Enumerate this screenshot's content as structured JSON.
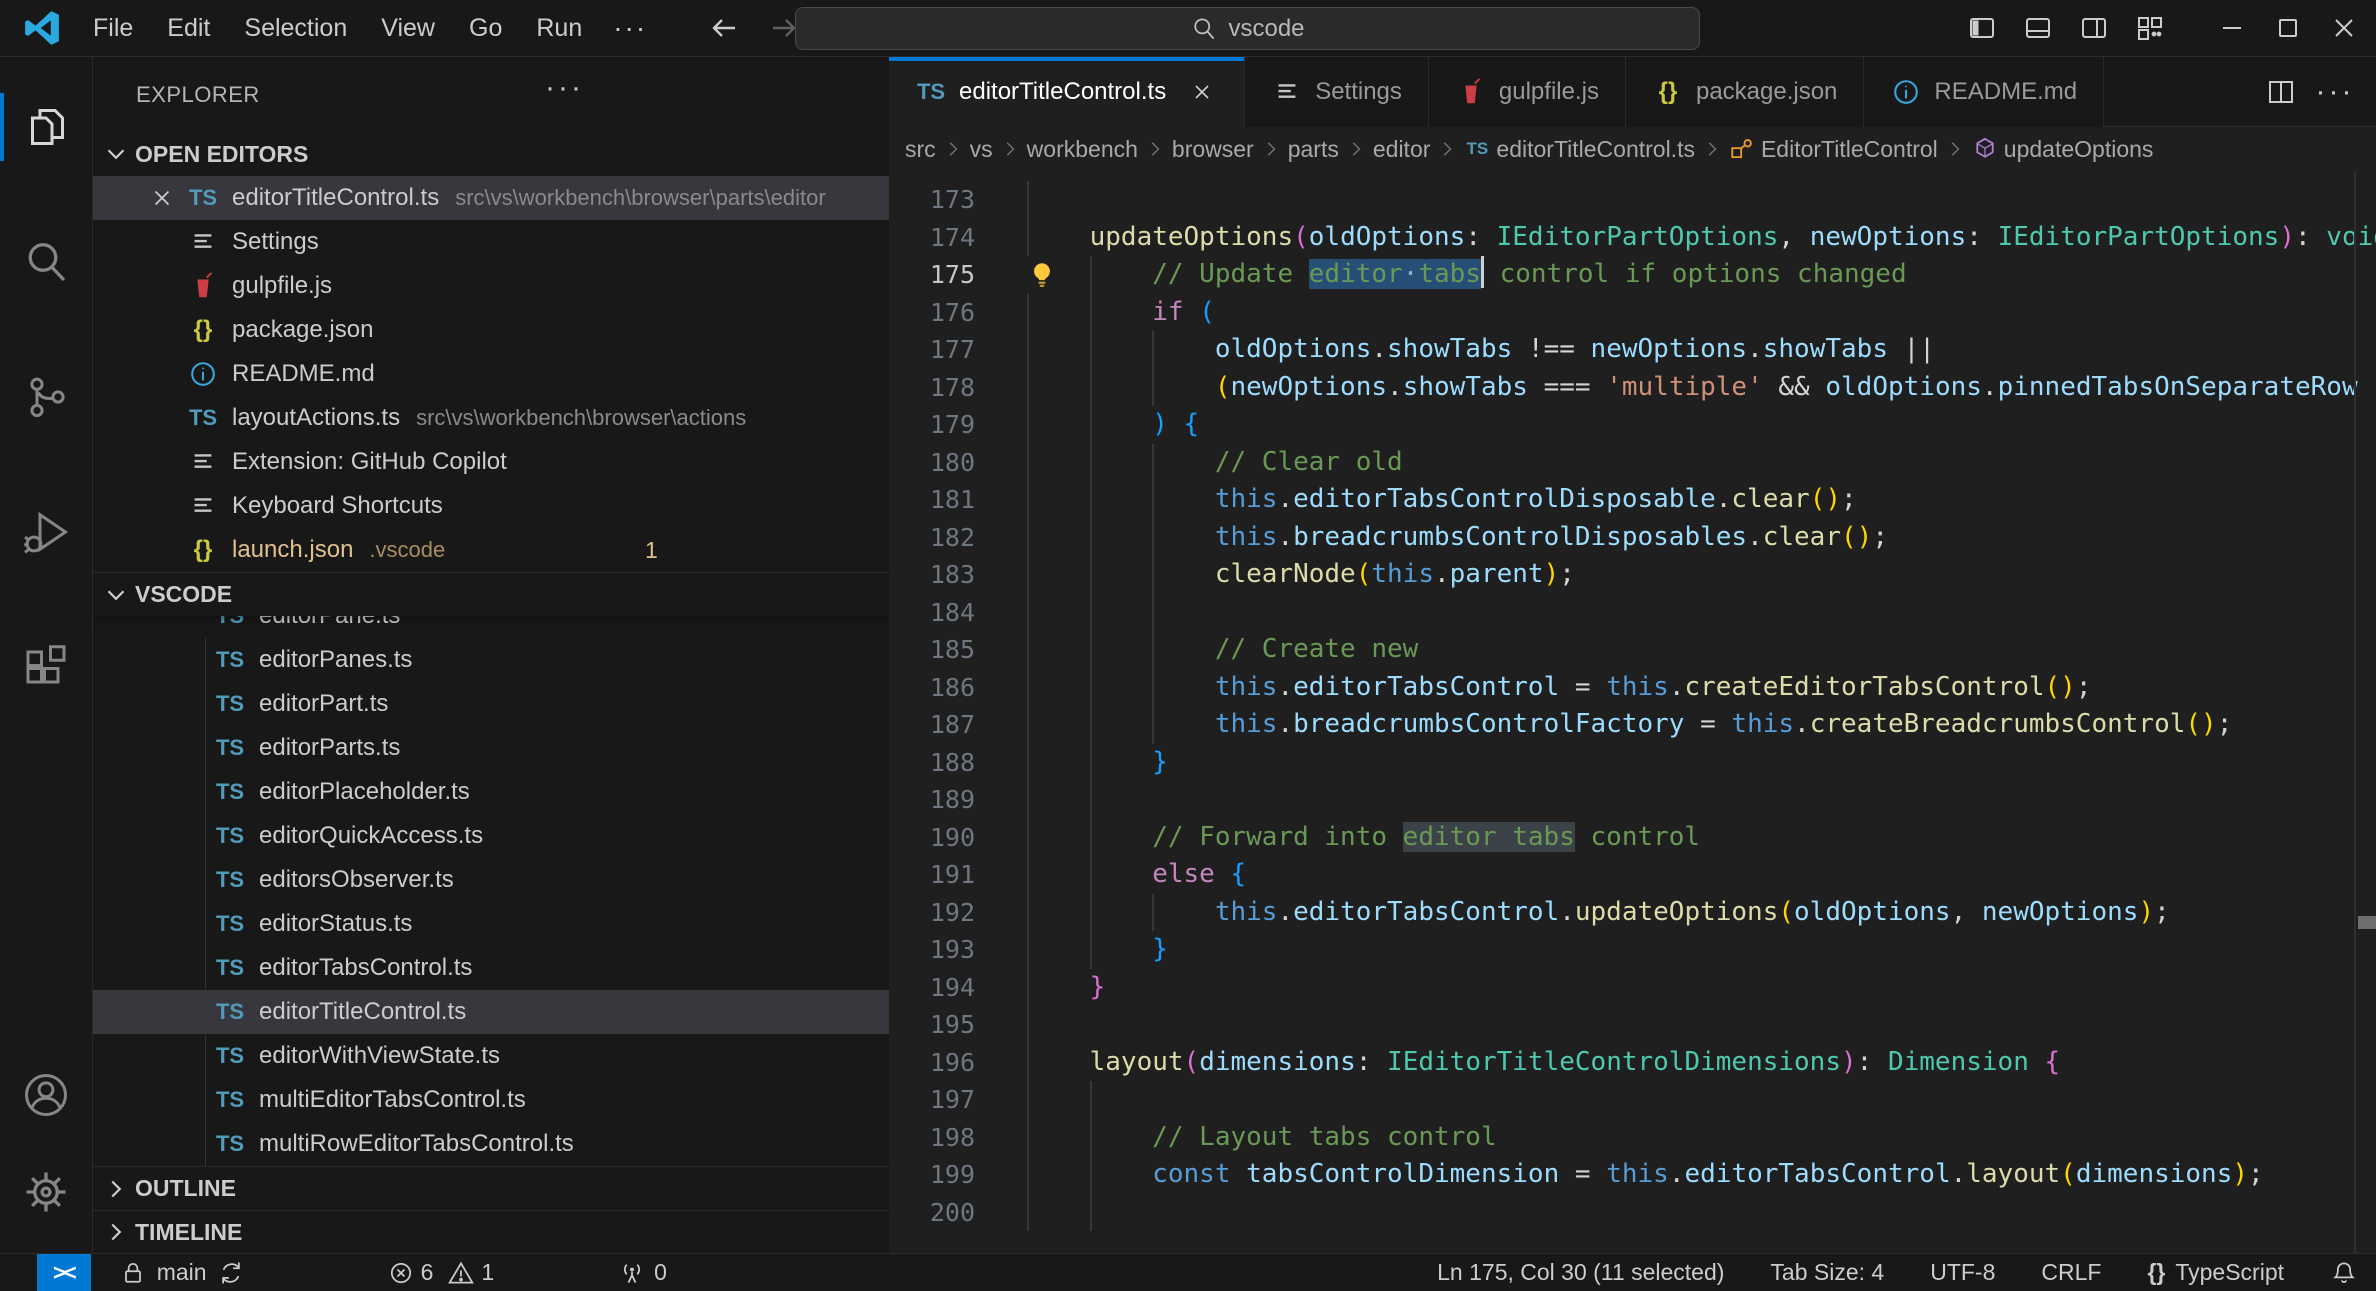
{
  "window": {
    "menus": [
      "File",
      "Edit",
      "Selection",
      "View",
      "Go",
      "Run"
    ],
    "more_label": "···",
    "search_value": "vscode"
  },
  "activity_bar": {
    "top": [
      {
        "icon": "files-icon",
        "active": true
      },
      {
        "icon": "search-icon"
      },
      {
        "icon": "source-control-icon"
      },
      {
        "icon": "run-debug-icon"
      },
      {
        "icon": "extensions-icon"
      }
    ],
    "bottom": [
      {
        "icon": "accounts-icon"
      },
      {
        "icon": "settings-gear-icon"
      }
    ]
  },
  "sidebar": {
    "title": "EXPLORER",
    "more_label": "···",
    "open_editors_label": "OPEN EDITORS",
    "open_editors": [
      {
        "icon": "ts",
        "name": "editorTitleControl.ts",
        "path": "src\\vs\\workbench\\browser\\parts\\editor",
        "selected": true,
        "close": true
      },
      {
        "icon": "settings",
        "name": "Settings"
      },
      {
        "icon": "gulp",
        "name": "gulpfile.js"
      },
      {
        "icon": "json",
        "name": "package.json"
      },
      {
        "icon": "info",
        "name": "README.md"
      },
      {
        "icon": "ts",
        "name": "layoutActions.ts",
        "path": "src\\vs\\workbench\\browser\\actions"
      },
      {
        "icon": "settings",
        "name": "Extension: GitHub Copilot"
      },
      {
        "icon": "settings",
        "name": "Keyboard Shortcuts"
      },
      {
        "icon": "json",
        "name": "launch.json",
        "path": ".vscode",
        "modified": true,
        "badge": "1"
      }
    ],
    "folder_label": "VSCODE",
    "tree_clipped_item": "editorPane.ts",
    "tree": [
      {
        "icon": "ts",
        "name": "editorPanes.ts"
      },
      {
        "icon": "ts",
        "name": "editorPart.ts"
      },
      {
        "icon": "ts",
        "name": "editorParts.ts"
      },
      {
        "icon": "ts",
        "name": "editorPlaceholder.ts"
      },
      {
        "icon": "ts",
        "name": "editorQuickAccess.ts"
      },
      {
        "icon": "ts",
        "name": "editorsObserver.ts"
      },
      {
        "icon": "ts",
        "name": "editorStatus.ts"
      },
      {
        "icon": "ts",
        "name": "editorTabsControl.ts"
      },
      {
        "icon": "ts",
        "name": "editorTitleControl.ts",
        "selected": true
      },
      {
        "icon": "ts",
        "name": "editorWithViewState.ts"
      },
      {
        "icon": "ts",
        "name": "multiEditorTabsControl.ts"
      },
      {
        "icon": "ts",
        "name": "multiRowEditorTabsControl.ts"
      }
    ],
    "outline_label": "OUTLINE",
    "timeline_label": "TIMELINE"
  },
  "tabs": [
    {
      "icon": "ts",
      "label": "editorTitleControl.ts",
      "active": true,
      "close": true
    },
    {
      "icon": "settings",
      "label": "Settings"
    },
    {
      "icon": "gulp",
      "label": "gulpfile.js"
    },
    {
      "icon": "json",
      "label": "package.json"
    },
    {
      "icon": "info",
      "label": "README.md"
    }
  ],
  "breadcrumbs": [
    {
      "label": "src"
    },
    {
      "label": "vs"
    },
    {
      "label": "workbench"
    },
    {
      "label": "browser"
    },
    {
      "label": "parts"
    },
    {
      "label": "editor"
    },
    {
      "label": "editorTitleControl.ts",
      "icon": "ts-small"
    },
    {
      "label": "EditorTitleControl",
      "icon": "class"
    },
    {
      "label": "updateOptions",
      "icon": "method"
    }
  ],
  "editor": {
    "lines": [
      {
        "n": 173,
        "i": 0,
        "g": 1,
        "tok": []
      },
      {
        "n": 174,
        "i": 1,
        "tok": [
          [
            "f",
            "updateOptions"
          ],
          [
            "b2",
            "("
          ],
          [
            "v",
            "oldOptions"
          ],
          [
            "p",
            ": "
          ],
          [
            "t",
            "IEditorPartOptions"
          ],
          [
            "p",
            ", "
          ],
          [
            "v",
            "newOptions"
          ],
          [
            "p",
            ": "
          ],
          [
            "t",
            "IEditorPartOptions"
          ],
          [
            "b2",
            ")"
          ],
          [
            "p",
            ": "
          ],
          [
            "t",
            "void"
          ],
          [
            "p",
            " "
          ],
          [
            "b2",
            "{"
          ]
        ]
      },
      {
        "n": 175,
        "i": 2,
        "active": true,
        "bulb": true,
        "tok": [
          [
            "m",
            "// Update "
          ],
          [
            "m sel",
            "editor"
          ],
          [
            "wsd sel",
            "·"
          ],
          [
            "m sel",
            "tabs"
          ],
          [
            "caret",
            ""
          ],
          [
            "m",
            " control if options changed"
          ]
        ]
      },
      {
        "n": 176,
        "i": 2,
        "tok": [
          [
            "c",
            "if"
          ],
          [
            "p",
            " "
          ],
          [
            "b3",
            "("
          ]
        ]
      },
      {
        "n": 177,
        "i": 3,
        "tok": [
          [
            "v",
            "oldOptions"
          ],
          [
            "p",
            "."
          ],
          [
            "v",
            "showTabs"
          ],
          [
            "p",
            " !== "
          ],
          [
            "v",
            "newOptions"
          ],
          [
            "p",
            "."
          ],
          [
            "v",
            "showTabs"
          ],
          [
            "p",
            " ||"
          ]
        ]
      },
      {
        "n": 178,
        "i": 3,
        "tok": [
          [
            "b1",
            "("
          ],
          [
            "v",
            "newOptions"
          ],
          [
            "p",
            "."
          ],
          [
            "v",
            "showTabs"
          ],
          [
            "p",
            " === "
          ],
          [
            "s",
            "'multiple'"
          ],
          [
            "p",
            " && "
          ],
          [
            "v",
            "oldOptions"
          ],
          [
            "p",
            "."
          ],
          [
            "v",
            "pinnedTabsOnSeparateRow"
          ],
          [
            "p",
            " !=="
          ]
        ]
      },
      {
        "n": 179,
        "i": 2,
        "tok": [
          [
            "b3",
            ") {"
          ]
        ]
      },
      {
        "n": 180,
        "i": 3,
        "tok": [
          [
            "m",
            "// Clear old"
          ]
        ]
      },
      {
        "n": 181,
        "i": 3,
        "tok": [
          [
            "k",
            "this"
          ],
          [
            "p",
            "."
          ],
          [
            "v",
            "editorTabsControlDisposable"
          ],
          [
            "p",
            "."
          ],
          [
            "f",
            "clear"
          ],
          [
            "b1",
            "()"
          ],
          [
            "p",
            ";"
          ]
        ]
      },
      {
        "n": 182,
        "i": 3,
        "tok": [
          [
            "k",
            "this"
          ],
          [
            "p",
            "."
          ],
          [
            "v",
            "breadcrumbsControlDisposables"
          ],
          [
            "p",
            "."
          ],
          [
            "f",
            "clear"
          ],
          [
            "b1",
            "()"
          ],
          [
            "p",
            ";"
          ]
        ]
      },
      {
        "n": 183,
        "i": 3,
        "tok": [
          [
            "f",
            "clearNode"
          ],
          [
            "b1",
            "("
          ],
          [
            "k",
            "this"
          ],
          [
            "p",
            "."
          ],
          [
            "v",
            "parent"
          ],
          [
            "b1",
            ")"
          ],
          [
            "p",
            ";"
          ]
        ]
      },
      {
        "n": 184,
        "i": 0,
        "g": 3,
        "tok": []
      },
      {
        "n": 185,
        "i": 3,
        "tok": [
          [
            "m",
            "// Create new"
          ]
        ]
      },
      {
        "n": 186,
        "i": 3,
        "tok": [
          [
            "k",
            "this"
          ],
          [
            "p",
            "."
          ],
          [
            "v",
            "editorTabsControl"
          ],
          [
            "p",
            " = "
          ],
          [
            "k",
            "this"
          ],
          [
            "p",
            "."
          ],
          [
            "f",
            "createEditorTabsControl"
          ],
          [
            "b1",
            "()"
          ],
          [
            "p",
            ";"
          ]
        ]
      },
      {
        "n": 187,
        "i": 3,
        "tok": [
          [
            "k",
            "this"
          ],
          [
            "p",
            "."
          ],
          [
            "v",
            "breadcrumbsControlFactory"
          ],
          [
            "p",
            " = "
          ],
          [
            "k",
            "this"
          ],
          [
            "p",
            "."
          ],
          [
            "f",
            "createBreadcrumbsControl"
          ],
          [
            "b1",
            "()"
          ],
          [
            "p",
            ";"
          ]
        ]
      },
      {
        "n": 188,
        "i": 2,
        "tok": [
          [
            "b3",
            "}"
          ]
        ]
      },
      {
        "n": 189,
        "i": 0,
        "g": 2,
        "tok": []
      },
      {
        "n": 190,
        "i": 2,
        "tok": [
          [
            "m",
            "// Forward into "
          ],
          [
            "m selm",
            "editor tabs"
          ],
          [
            "m",
            " control"
          ]
        ]
      },
      {
        "n": 191,
        "i": 2,
        "tok": [
          [
            "c",
            "else"
          ],
          [
            "p",
            " "
          ],
          [
            "b3",
            "{"
          ]
        ]
      },
      {
        "n": 192,
        "i": 3,
        "tok": [
          [
            "k",
            "this"
          ],
          [
            "p",
            "."
          ],
          [
            "v",
            "editorTabsControl"
          ],
          [
            "p",
            "."
          ],
          [
            "f",
            "updateOptions"
          ],
          [
            "b1",
            "("
          ],
          [
            "v",
            "oldOptions"
          ],
          [
            "p",
            ", "
          ],
          [
            "v",
            "newOptions"
          ],
          [
            "b1",
            ")"
          ],
          [
            "p",
            ";"
          ]
        ]
      },
      {
        "n": 193,
        "i": 2,
        "tok": [
          [
            "b3",
            "}"
          ]
        ]
      },
      {
        "n": 194,
        "i": 1,
        "tok": [
          [
            "b2",
            "}"
          ]
        ]
      },
      {
        "n": 195,
        "i": 0,
        "g": 1,
        "tok": []
      },
      {
        "n": 196,
        "i": 1,
        "tok": [
          [
            "f",
            "layout"
          ],
          [
            "b2",
            "("
          ],
          [
            "v",
            "dimensions"
          ],
          [
            "p",
            ": "
          ],
          [
            "t",
            "IEditorTitleControlDimensions"
          ],
          [
            "b2",
            ")"
          ],
          [
            "p",
            ": "
          ],
          [
            "t",
            "Dimension"
          ],
          [
            "p",
            " "
          ],
          [
            "b2",
            "{"
          ]
        ]
      },
      {
        "n": 197,
        "i": 0,
        "g": 2,
        "tok": []
      },
      {
        "n": 198,
        "i": 2,
        "tok": [
          [
            "m",
            "// Layout tabs control"
          ]
        ]
      },
      {
        "n": 199,
        "i": 2,
        "tok": [
          [
            "k",
            "const"
          ],
          [
            "p",
            " "
          ],
          [
            "v",
            "tabsControlDimension"
          ],
          [
            "p",
            " = "
          ],
          [
            "k",
            "this"
          ],
          [
            "p",
            "."
          ],
          [
            "v",
            "editorTabsControl"
          ],
          [
            "p",
            "."
          ],
          [
            "f",
            "layout"
          ],
          [
            "b1",
            "("
          ],
          [
            "v",
            "dimensions"
          ],
          [
            "b1",
            ")"
          ],
          [
            "p",
            ";"
          ]
        ]
      },
      {
        "n": 200,
        "i": 0,
        "g": 2,
        "tok": []
      }
    ]
  },
  "status_bar": {
    "remote": "><",
    "branch": "main",
    "errors": "6",
    "warnings": "1",
    "ports": "0",
    "line_col": "Ln 175, Col 30 (11 selected)",
    "tab_size": "Tab Size: 4",
    "encoding": "UTF-8",
    "eol": "CRLF",
    "braces": "{}",
    "language": "TypeScript"
  }
}
